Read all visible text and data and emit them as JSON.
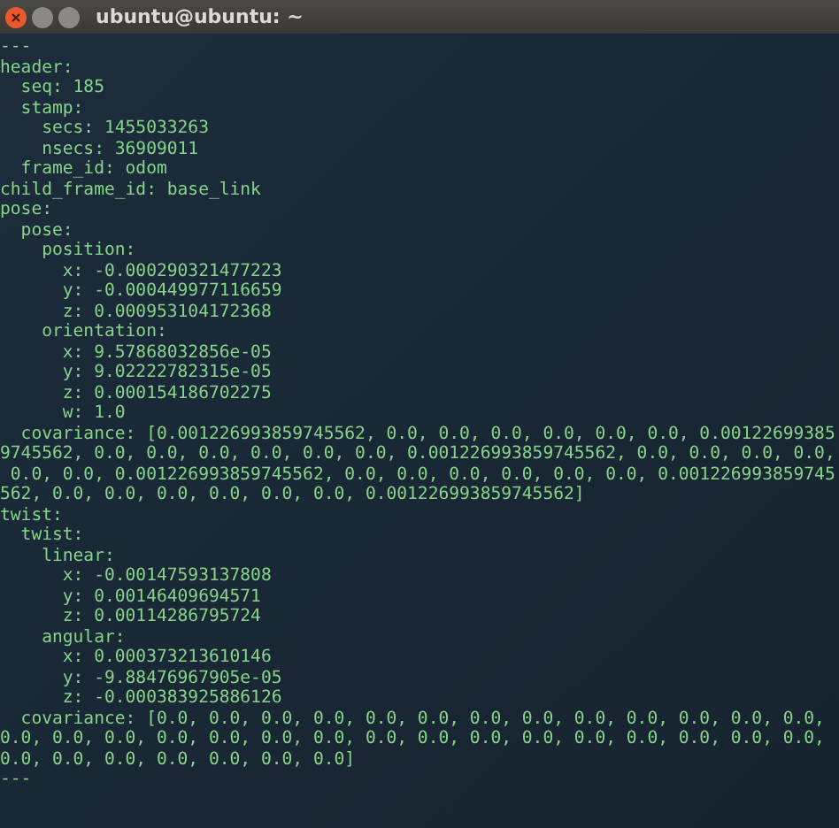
{
  "window": {
    "title": "ubuntu@ubuntu: ~"
  },
  "terminal": {
    "lines": [
      "---",
      "header:",
      "  seq: 185",
      "  stamp:",
      "    secs: 1455033263",
      "    nsecs: 36909011",
      "  frame_id: odom",
      "child_frame_id: base_link",
      "pose:",
      "  pose:",
      "    position:",
      "      x: -0.000290321477223",
      "      y: -0.000449977116659",
      "      z: 0.000953104172368",
      "    orientation:",
      "      x: 9.57868032856e-05",
      "      y: 9.02222782315e-05",
      "      z: 0.000154186702275",
      "      w: 1.0",
      "  covariance: [0.001226993859745562, 0.0, 0.0, 0.0, 0.0, 0.0, 0.0, 0.00122699385",
      "9745562, 0.0, 0.0, 0.0, 0.0, 0.0, 0.0, 0.001226993859745562, 0.0, 0.0, 0.0, 0.0,",
      " 0.0, 0.0, 0.001226993859745562, 0.0, 0.0, 0.0, 0.0, 0.0, 0.0, 0.001226993859745",
      "562, 0.0, 0.0, 0.0, 0.0, 0.0, 0.0, 0.001226993859745562]",
      "twist:",
      "  twist:",
      "    linear:",
      "      x: -0.00147593137808",
      "      y: 0.00146409694571",
      "      z: 0.00114286795724",
      "    angular:",
      "      x: 0.000373213610146",
      "      y: -9.88476967905e-05",
      "      z: -0.000383925886126",
      "  covariance: [0.0, 0.0, 0.0, 0.0, 0.0, 0.0, 0.0, 0.0, 0.0, 0.0, 0.0, 0.0, 0.0,",
      "0.0, 0.0, 0.0, 0.0, 0.0, 0.0, 0.0, 0.0, 0.0, 0.0, 0.0, 0.0, 0.0, 0.0, 0.0, 0.0,",
      "0.0, 0.0, 0.0, 0.0, 0.0, 0.0, 0.0]",
      "---"
    ]
  }
}
